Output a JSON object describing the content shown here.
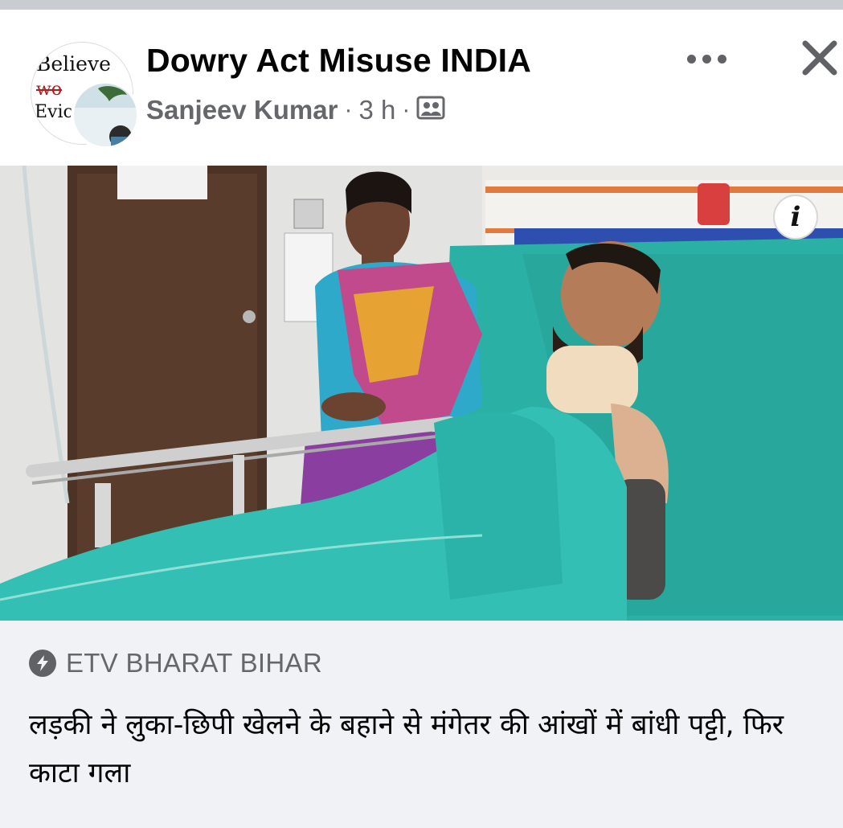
{
  "post": {
    "group_name": "Dowry Act Misuse INDIA",
    "author": "Sanjeev Kumar",
    "separator": "·",
    "time": "3 h",
    "audience_icon": "group-photo-icon",
    "more_icon": "more-dots-icon",
    "close_icon": "close-icon"
  },
  "group_avatar": {
    "line1": "Believe",
    "line2": "wo",
    "line3": "Evic"
  },
  "photo": {
    "info_label": "i"
  },
  "link_preview": {
    "source": "ETV BHARAT BIHAR",
    "source_icon": "lightning-bolt-icon",
    "headline": "लड़की ने लुका-छिपी खेलने के बहाने से मंगेतर की आंखों में बांधी पट्टी, फिर काटा गला"
  },
  "colors": {
    "primary_text": "#050505",
    "secondary_text": "#65676b",
    "caption_bg": "#f0f2f5",
    "bedsheet": "#2bb3a9"
  }
}
